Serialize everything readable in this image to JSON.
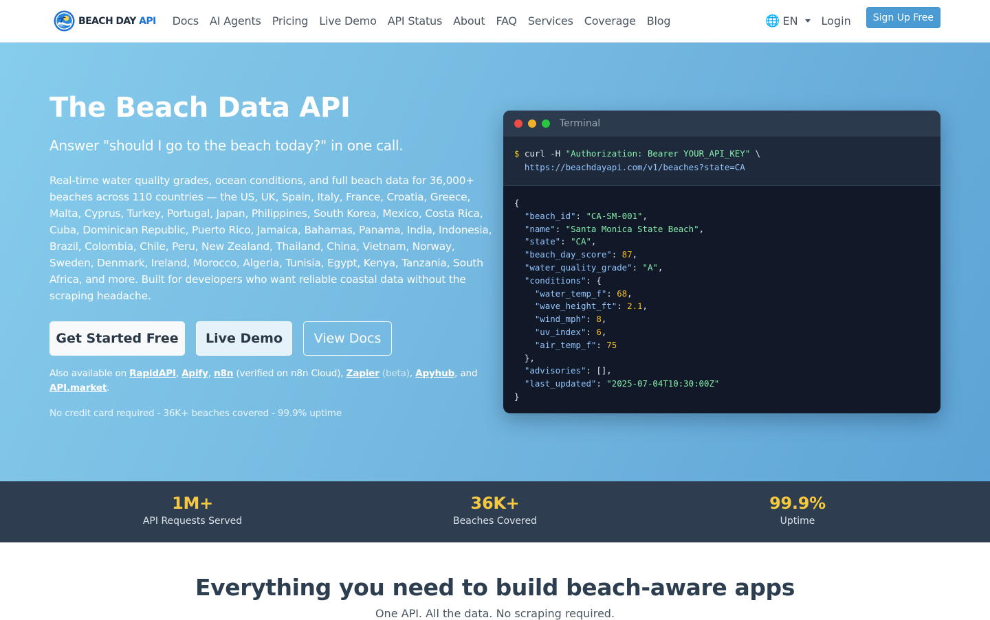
{
  "brand": {
    "name_main": "BEACH DAY ",
    "name_accent": "API",
    "icon": "beach-sun-logo"
  },
  "nav": {
    "links": [
      "Docs",
      "AI Agents",
      "Pricing",
      "Live Demo",
      "API Status",
      "About",
      "FAQ",
      "Services",
      "Coverage",
      "Blog"
    ],
    "language": "EN",
    "login": "Login",
    "signup": "Sign Up Free"
  },
  "hero": {
    "title": "The Beach Data API",
    "subtitle": "Answer \"should I go to the beach today?\" in one call.",
    "description": "Real-time water quality grades, ocean conditions, and full beach data for 36,000+ beaches across 110 countries — the US, UK, Spain, Italy, France, Croatia, Greece, Malta, Cyprus, Turkey, Portugal, Japan, Philippines, South Korea, Mexico, Costa Rica, Cuba, Dominican Republic, Puerto Rico, Jamaica, Bahamas, Panama, India, Indonesia, Brazil, Colombia, Chile, Peru, New Zealand, Thailand, China, Vietnam, Norway, Sweden, Denmark, Ireland, Morocco, Algeria, Tunisia, Egypt, Kenya, Tanzania, South Africa, and more. Built for developers who want reliable coastal data without the scraping headache.",
    "buttons": {
      "primary": "Get Started Free",
      "demo": "Live Demo",
      "docs": "View Docs"
    },
    "also": {
      "prefix": "Also available on ",
      "rapidapi": "RapidAPI",
      "sep1": ", ",
      "apify": "Apify",
      "sep2": ", ",
      "n8n": "n8n",
      "n8n_note": " (verified on n8n Cloud), ",
      "zapier": "Zapier",
      "beta": " (beta)",
      "sep3": ", ",
      "apyhub": "Apyhub",
      "and": ", and ",
      "apimarket": "API.market",
      "end": "."
    },
    "footnote": "No credit card required - 36K+ beaches covered - 99.9% uptime"
  },
  "terminal": {
    "title": "Terminal",
    "prompt": "$",
    "cmd": " curl -H ",
    "auth": "\"Authorization: Bearer YOUR_API_KEY\"",
    "cont": " \\",
    "url": "https://beachdayapi.com/v1/beaches?state=CA",
    "json": {
      "beach_id": "\"CA-SM-001\"",
      "name": "\"Santa Monica State Beach\"",
      "state": "\"CA\"",
      "beach_day_score": "87",
      "water_quality_grade": "\"A\"",
      "water_temp_f": "68",
      "wave_height_ft": "2.1",
      "wind_mph": "8",
      "uv_index": "6",
      "air_temp_f": "75",
      "advisories": "[]",
      "last_updated": "\"2025-07-04T10:30:00Z\""
    }
  },
  "stats": [
    {
      "value": "1M+",
      "label": "API Requests Served"
    },
    {
      "value": "36K+",
      "label": "Beaches Covered"
    },
    {
      "value": "99.9%",
      "label": "Uptime"
    }
  ],
  "features": {
    "title": "Everything you need to build beach-aware apps",
    "subtitle": "One API. All the data. No scraping required."
  },
  "colors": {
    "hero_start": "#86ccec",
    "hero_end": "#5da4d6",
    "stats_bg": "#2e3d4f",
    "stat_accent": "#f5c842",
    "brand_accent": "#1a73d9"
  }
}
